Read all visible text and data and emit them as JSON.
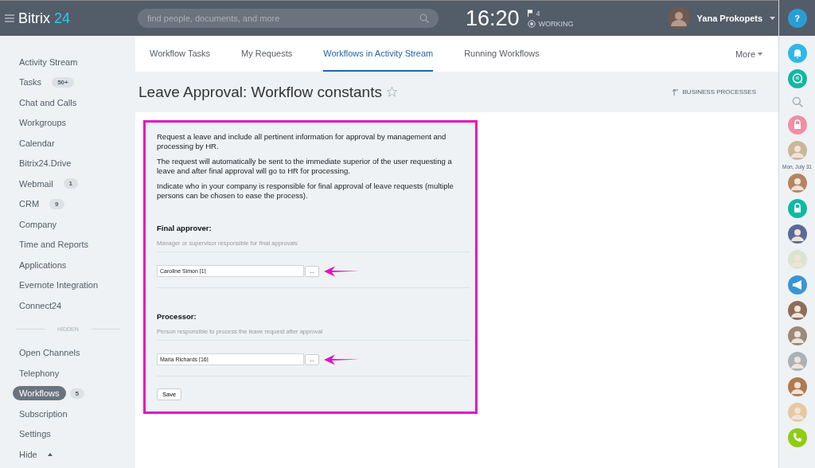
{
  "header": {
    "logo": "Bitrix",
    "logo_accent": "24",
    "search": {
      "placeholder": "find people, documents, and more"
    },
    "time": "16:20",
    "flags": "4",
    "status": "WORKING",
    "user": "Yana Prokopets"
  },
  "sidebar": {
    "items": [
      {
        "label": "Activity Stream",
        "selected": false
      },
      {
        "label": "Tasks",
        "badge": "50+",
        "selected": false
      },
      {
        "label": "Chat and Calls",
        "selected": false
      },
      {
        "label": "Workgroups",
        "selected": false
      },
      {
        "label": "Calendar",
        "selected": false
      },
      {
        "label": "Bitrix24.Drive",
        "selected": false
      },
      {
        "label": "Webmail",
        "badge": "1",
        "selected": false
      },
      {
        "label": "CRM",
        "badge": "9",
        "selected": false
      },
      {
        "label": "Company",
        "selected": false
      },
      {
        "label": "Time and Reports",
        "selected": false
      },
      {
        "label": "Applications",
        "selected": false
      },
      {
        "label": "Evernote Integration",
        "selected": false
      },
      {
        "label": "Connect24",
        "selected": false
      }
    ],
    "hidden_label": "HIDDEN",
    "hidden_items": [
      {
        "label": "Open Channels",
        "selected": false
      },
      {
        "label": "Telephony",
        "selected": false
      },
      {
        "label": "Workflows",
        "badge": "5",
        "selected": true
      },
      {
        "label": "Subscription",
        "selected": false
      },
      {
        "label": "Settings",
        "selected": false
      }
    ],
    "toggle": "Hide"
  },
  "tabs": [
    {
      "label": "Workflow Tasks",
      "selected": false
    },
    {
      "label": "My Requests",
      "selected": false
    },
    {
      "label": "Workflows in Activity Stream",
      "selected": true
    },
    {
      "label": "Running Workflows",
      "selected": false
    }
  ],
  "more": "More",
  "page_title": "Leave Approval: Workflow constants",
  "back_link": "BUSINESS PROCESSES",
  "form": {
    "highlighted": true,
    "paragraphs": [
      "Request a leave and include all pertinent information for approval by management and processing by HR.",
      "The request will automatically be sent to the immediate superior of the user requesting a leave and after final approval will go to HR for processing.",
      "Indicate who in your company is responsible for final approval of leave requests (multiple persons can be chosen to ease the process)."
    ],
    "fields": [
      {
        "heading": "Final approver:",
        "hint": "Manager or supervisor responsible for final approvals",
        "value": "Caroline Simon [1]",
        "button": "...",
        "highlighted": true
      },
      {
        "heading": "Processor:",
        "hint": "Person responsible to process the leave request after approval",
        "value": "Maria Richards [16]",
        "button": "...",
        "highlighted": true
      }
    ],
    "save": "Save"
  },
  "right_bar": {
    "help": "?",
    "items": [
      {
        "kind": "bell",
        "color": "#2fb8e6"
      },
      {
        "kind": "chat",
        "color": "#11b8a5"
      },
      {
        "kind": "search"
      },
      {
        "kind": "lock",
        "color": "#ee8fa6"
      },
      {
        "kind": "avatar",
        "color": "#c9b79a"
      },
      {
        "kind": "date",
        "text": "Mon, July 31"
      },
      {
        "kind": "avatar",
        "color": "#b58563"
      },
      {
        "kind": "lock",
        "color": "#11b8a5"
      },
      {
        "kind": "avatar",
        "color": "#5a6a9a"
      },
      {
        "kind": "avatar",
        "color": "#d8e6d0"
      },
      {
        "kind": "megaphone",
        "color": "#3a95d6"
      },
      {
        "kind": "avatar",
        "color": "#8d6e5a"
      },
      {
        "kind": "avatar",
        "color": "#9b8a78"
      },
      {
        "kind": "avatar",
        "color": "#a9b2b8"
      },
      {
        "kind": "avatar",
        "color": "#b07a50"
      },
      {
        "kind": "avatar",
        "color": "#e6c9a0"
      },
      {
        "kind": "phone",
        "color": "#8fcc14"
      }
    ]
  }
}
